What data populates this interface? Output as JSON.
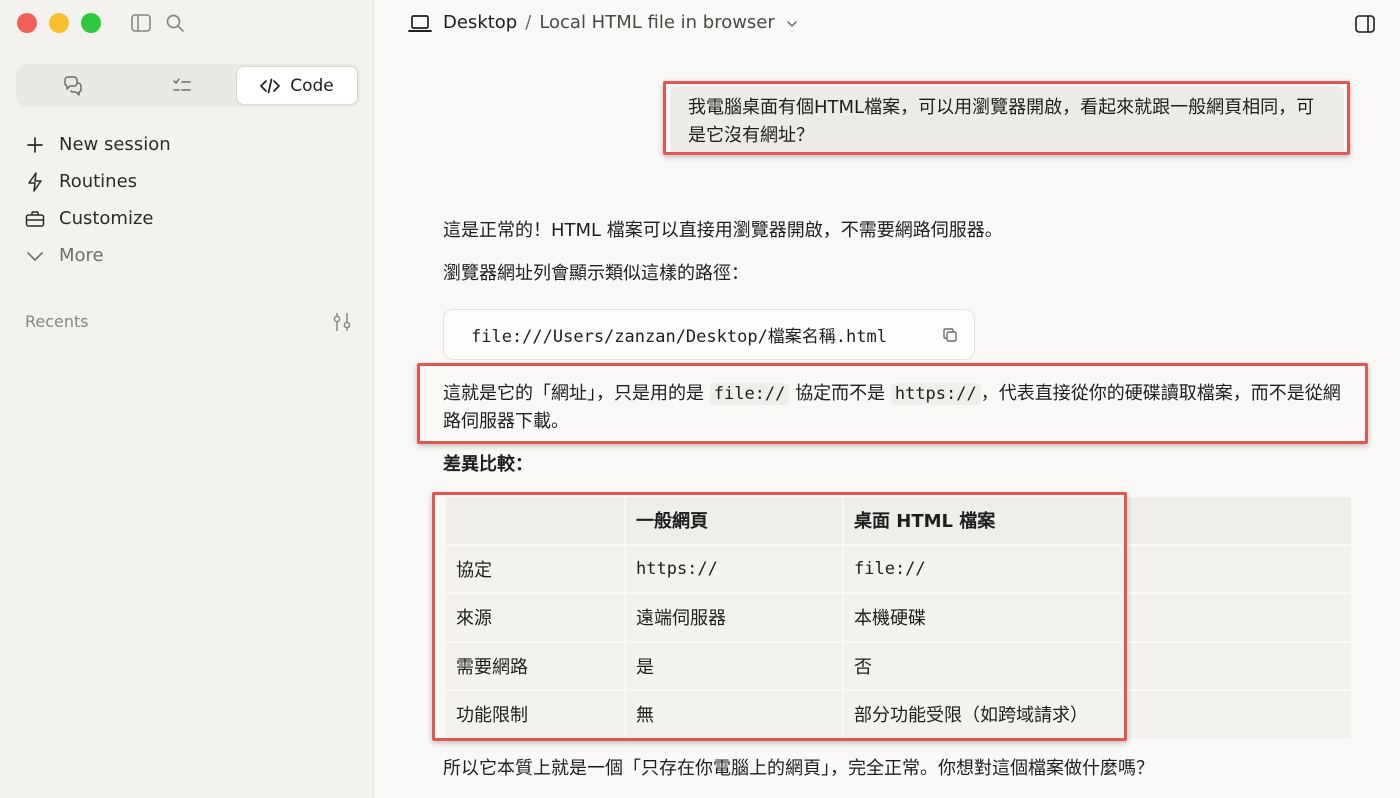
{
  "sidebar": {
    "segments": [
      {
        "icon": "chat-bubbles-icon"
      },
      {
        "icon": "checklist-icon"
      },
      {
        "icon": "code-brackets-icon",
        "label": "Code"
      }
    ],
    "nav": [
      {
        "icon": "plus-icon",
        "label": "New session"
      },
      {
        "icon": "lightning-icon",
        "label": "Routines"
      },
      {
        "icon": "briefcase-icon",
        "label": "Customize"
      },
      {
        "icon": "chevron-down-icon",
        "label": "More"
      }
    ],
    "recents_label": "Recents"
  },
  "header": {
    "root": "Desktop",
    "separator": "/",
    "current": "Local HTML file in browser"
  },
  "conversation": {
    "user_message": "我電腦桌面有個HTML檔案，可以用瀏覽器開啟，看起來就跟一般網頁相同，可是它沒有網址？",
    "reply": {
      "p1": "這是正常的！HTML 檔案可以直接用瀏覽器開啟，不需要網路伺服器。",
      "p2": "瀏覽器網址列會顯示類似這樣的路徑：",
      "code": "file:///Users/zanzan/Desktop/檔案名稱.html",
      "p3_part1": "這就是它的「網址」，只是用的是 ",
      "p3_code1": "file://",
      "p3_part2": " 協定而不是 ",
      "p3_code2": "https://",
      "p3_part3": "，代表直接從你的硬碟讀取檔案，而不是從網路伺服器下載。",
      "p4": "差異比較：",
      "table": {
        "headers": [
          "",
          "一般網頁",
          "桌面 HTML 檔案"
        ],
        "rows": [
          [
            "協定",
            "https://",
            "file://"
          ],
          [
            "來源",
            "遠端伺服器",
            "本機硬碟"
          ],
          [
            "需要網路",
            "是",
            "否"
          ],
          [
            "功能限制",
            "無",
            "部分功能受限（如跨域請求）"
          ]
        ]
      },
      "p5": "所以它本質上就是一個「只存在你電腦上的網頁」，完全正常。你想對這個檔案做什麼嗎？"
    }
  },
  "colors": {
    "annotation": "#e0574f",
    "traffic_red": "#f15f57",
    "traffic_yellow": "#f7bf2e",
    "traffic_green": "#2bc840"
  }
}
